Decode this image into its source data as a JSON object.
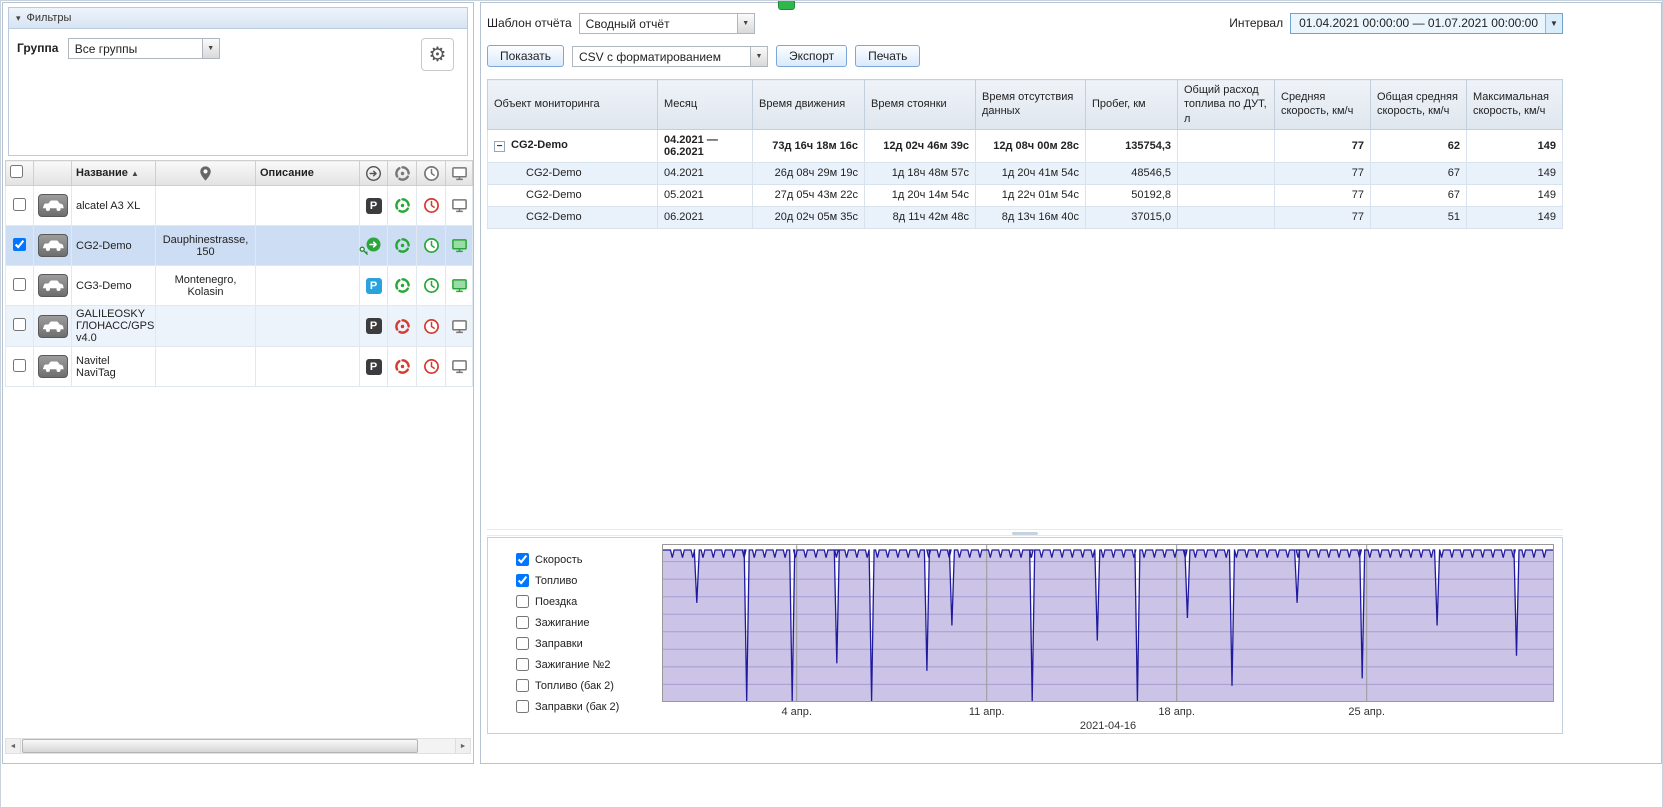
{
  "icons": {
    "gear": "⚙",
    "dropdown_arrow": "▼",
    "select_arrow": "▼",
    "sort_asc": "▲",
    "collapse_arrow": "▾",
    "expander_minus": "−",
    "scroll_left": "◄",
    "scroll_right": "►",
    "parking_letter": "P"
  },
  "left_panel": {
    "filters": {
      "title": "Фильтры",
      "group_label": "Группа",
      "group_value": "Все группы"
    },
    "table": {
      "name_header": "Название",
      "description_header": "Описание",
      "rows": [
        {
          "name": "alcatel A3 XL",
          "location": "",
          "description": "",
          "checked": false,
          "motion": "parked-dark",
          "connection": "green",
          "data_age": "red",
          "online": "offline"
        },
        {
          "name": "CG2-Demo",
          "location": "Dauphinestrasse, 150",
          "description": "",
          "checked": true,
          "motion": "moving-ignition-green",
          "connection": "green",
          "data_age": "green",
          "online": "online"
        },
        {
          "name": "CG3-Demo",
          "location": "Montenegro, Kolasin",
          "description": "",
          "checked": false,
          "motion": "parked-blue",
          "connection": "green",
          "data_age": "green",
          "online": "online"
        },
        {
          "name": "GALILEOSKY ГЛОНАСС/GPS v4.0",
          "location": "",
          "description": "",
          "checked": false,
          "motion": "parked-dark",
          "connection": "red",
          "data_age": "red",
          "online": "offline"
        },
        {
          "name": "Navitel NaviTag",
          "location": "",
          "description": "",
          "checked": false,
          "motion": "parked-dark",
          "connection": "red",
          "data_age": "red",
          "online": "offline"
        }
      ]
    }
  },
  "report": {
    "template_label": "Шаблон отчёта",
    "template_value": "Сводный отчёт",
    "interval_label": "Интервал",
    "interval_value": "01.04.2021 00:00:00 — 01.07.2021 00:00:00",
    "show_button": "Показать",
    "export_format": "CSV с форматированием",
    "export_button": "Экспорт",
    "print_button": "Печать",
    "table": {
      "headers": [
        "Объект мониторинга",
        "Месяц",
        "Время движения",
        "Время стоянки",
        "Время отсутствия данных",
        "Пробег, км",
        "Общий расход топлива по ДУТ, л",
        "Средняя скорость, км/ч",
        "Общая средняя скорость, км/ч",
        "Максимальная скорость, км/ч"
      ],
      "summary_row": {
        "object": "CG2-Demo",
        "month": "04.2021 — 06.2021",
        "moving_time": "73д 16ч 18м 16с",
        "parking_time": "12д 02ч 46м 39с",
        "no_data_time": "12д 08ч 00м 28с",
        "mileage": "135754,3",
        "fuel": "",
        "avg_speed": "77",
        "overall_avg_speed": "62",
        "max_speed": "149"
      },
      "rows": [
        {
          "object": "CG2-Demo",
          "month": "04.2021",
          "moving_time": "26д 08ч 29м 19с",
          "parking_time": "1д 18ч 48м 57с",
          "no_data_time": "1д 20ч 41м 54с",
          "mileage": "48546,5",
          "fuel": "",
          "avg_speed": "77",
          "overall_avg_speed": "67",
          "max_speed": "149"
        },
        {
          "object": "CG2-Demo",
          "month": "05.2021",
          "moving_time": "27д 05ч 43м 22с",
          "parking_time": "1д 20ч 14м 54с",
          "no_data_time": "1д 22ч 01м 54с",
          "mileage": "50192,8",
          "fuel": "",
          "avg_speed": "77",
          "overall_avg_speed": "67",
          "max_speed": "149"
        },
        {
          "object": "CG2-Demo",
          "month": "06.2021",
          "moving_time": "20д 02ч 05м 35с",
          "parking_time": "8д 11ч 42м 48с",
          "no_data_time": "8д 13ч 16м 40с",
          "mileage": "37015,0",
          "fuel": "",
          "avg_speed": "77",
          "overall_avg_speed": "51",
          "max_speed": "149"
        }
      ]
    }
  },
  "chart_panel": {
    "legend": [
      {
        "label": "Скорость",
        "checked": true
      },
      {
        "label": "Топливо",
        "checked": true
      },
      {
        "label": "Поездка",
        "checked": false
      },
      {
        "label": "Зажигание",
        "checked": false
      },
      {
        "label": "Заправки",
        "checked": false
      },
      {
        "label": "Зажигание №2",
        "checked": false
      },
      {
        "label": "Топливо (бак 2)",
        "checked": false
      },
      {
        "label": "Заправки (бак 2)",
        "checked": false
      }
    ]
  },
  "chart_data": {
    "type": "area",
    "series_name": "Скорость",
    "x_ticks": [
      "4 апр.",
      "11 апр.",
      "18 апр.",
      "25 апр."
    ],
    "x_tick_fractions": [
      0.151,
      0.364,
      0.577,
      0.79
    ],
    "center_label": "2021-04-16",
    "line_color": "#201b9e",
    "fill_color": "#cbc4e6",
    "h_grid_color": "#a79bd2",
    "v_grid_color": "#9a9a9a",
    "h_grid_count": 9,
    "minor_dip_spacing": 0.0115,
    "minor_dip_depth": 0.05,
    "major_dips": [
      {
        "x": 0.039,
        "depth": 0.35
      },
      {
        "x": 0.095,
        "depth": 1.0
      },
      {
        "x": 0.146,
        "depth": 1.0
      },
      {
        "x": 0.196,
        "depth": 0.75
      },
      {
        "x": 0.235,
        "depth": 1.0
      },
      {
        "x": 0.297,
        "depth": 0.8
      },
      {
        "x": 0.325,
        "depth": 0.5
      },
      {
        "x": 0.415,
        "depth": 1.0
      },
      {
        "x": 0.488,
        "depth": 0.6
      },
      {
        "x": 0.533,
        "depth": 1.0
      },
      {
        "x": 0.589,
        "depth": 0.45
      },
      {
        "x": 0.639,
        "depth": 0.9
      },
      {
        "x": 0.712,
        "depth": 0.35
      },
      {
        "x": 0.785,
        "depth": 0.85
      },
      {
        "x": 0.869,
        "depth": 0.5
      },
      {
        "x": 0.958,
        "depth": 0.7
      }
    ]
  }
}
